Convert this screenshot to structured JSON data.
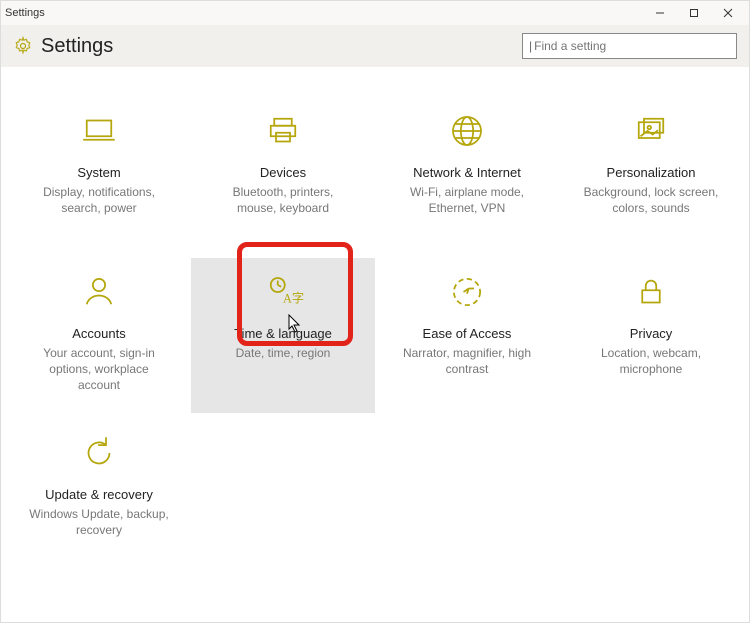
{
  "window": {
    "title": "Settings"
  },
  "header": {
    "title": "Settings"
  },
  "search": {
    "placeholder": "Find a setting"
  },
  "tiles": {
    "system": {
      "label": "System",
      "desc": "Display, notifications, search, power"
    },
    "devices": {
      "label": "Devices",
      "desc": "Bluetooth, printers, mouse, keyboard"
    },
    "network": {
      "label": "Network & Internet",
      "desc": "Wi-Fi, airplane mode, Ethernet, VPN"
    },
    "personalize": {
      "label": "Personalization",
      "desc": "Background, lock screen, colors, sounds"
    },
    "accounts": {
      "label": "Accounts",
      "desc": "Your account, sign-in options, workplace account"
    },
    "timelang": {
      "label": "Time & language",
      "desc": "Date, time, region"
    },
    "ease": {
      "label": "Ease of Access",
      "desc": "Narrator, magnifier, high contrast"
    },
    "privacy": {
      "label": "Privacy",
      "desc": "Location, webcam, microphone"
    },
    "update": {
      "label": "Update & recovery",
      "desc": "Windows Update, backup, recovery"
    }
  },
  "colors": {
    "accent": "#b4a60b",
    "highlight": "#e2231a"
  }
}
